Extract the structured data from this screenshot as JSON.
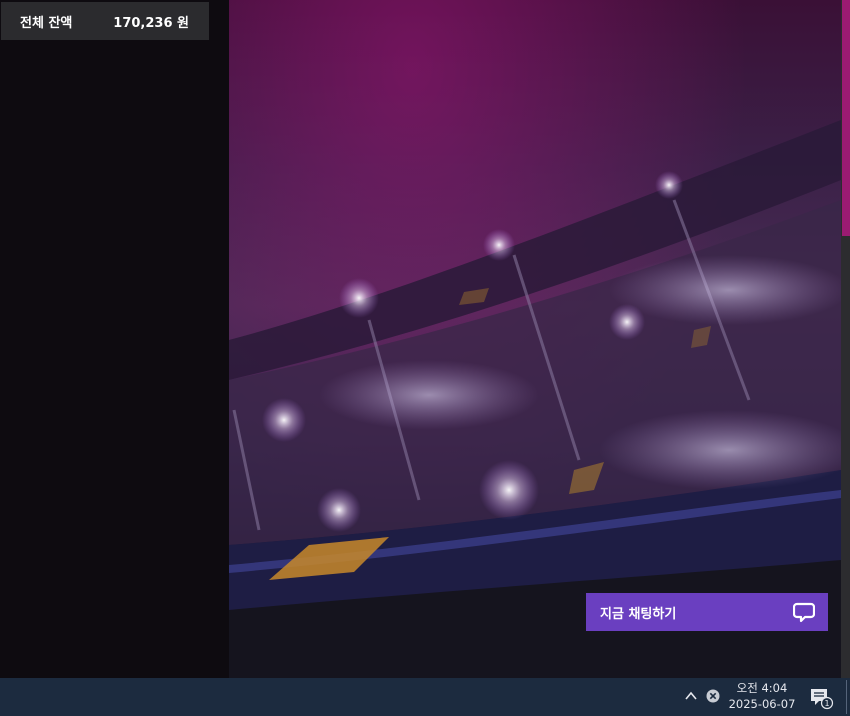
{
  "balance": {
    "label": "전체 잔액",
    "amount": "170,236 원"
  },
  "chat": {
    "label": "지금 채팅하기",
    "icon": "chat-bubble-icon"
  },
  "taskbar": {
    "clock_period": "오전 4:04",
    "clock_date": "2025-06-07",
    "notification_count": "1"
  },
  "colors": {
    "accent": "#6a3fc0",
    "scroll_thumb": "#9b1b72",
    "taskbar": "#1c2b3f"
  }
}
